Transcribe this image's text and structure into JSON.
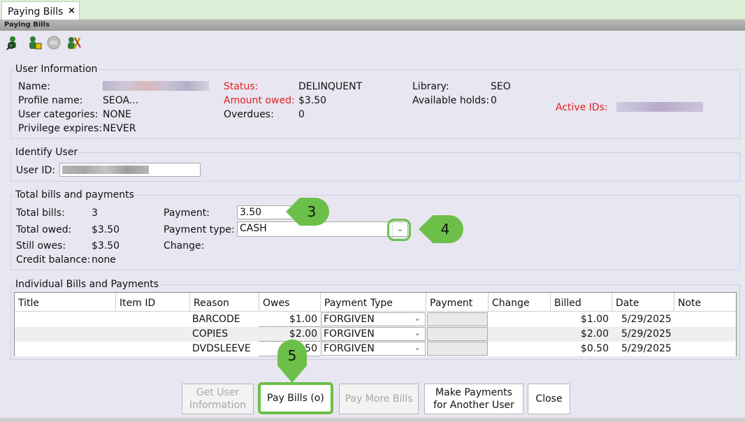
{
  "tab": {
    "label": "Paying Bills",
    "close": "×"
  },
  "window": {
    "title": "Paying Bills"
  },
  "toolbar": {
    "icons": [
      "user-search-icon",
      "user-add-icon",
      "disabled-icon",
      "tools-icon"
    ]
  },
  "user_info": {
    "legend": "User Information",
    "name_label": "Name:",
    "profile_label": "Profile name:",
    "profile_value": "SEOA...",
    "categories_label": "User categories:",
    "categories_value": "NONE",
    "privilege_label": "Privilege expires:",
    "privilege_value": "NEVER",
    "status_label": "Status:",
    "status_value": "DELINQUENT",
    "amount_label": "Amount owed:",
    "amount_value": "$3.50",
    "overdues_label": "Overdues:",
    "overdues_value": "0",
    "library_label": "Library:",
    "library_value": "SEO",
    "holds_label": "Available holds:",
    "holds_value": "0",
    "active_ids_label": "Active IDs:"
  },
  "identify": {
    "legend": "Identify User",
    "user_id_label": "User ID:"
  },
  "totals": {
    "legend": "Total bills and payments",
    "total_bills_label": "Total bills:",
    "total_bills_value": "3",
    "total_owed_label": "Total owed:",
    "total_owed_value": "$3.50",
    "still_owes_label": "Still owes:",
    "still_owes_value": "$3.50",
    "credit_label": "Credit balance:",
    "credit_value": "none",
    "payment_label": "Payment:",
    "payment_value": "3.50",
    "payment_type_label": "Payment type:",
    "payment_type_value": "CASH",
    "change_label": "Change:"
  },
  "bills": {
    "legend": "Individual Bills and Payments",
    "columns": [
      "Title",
      "Item ID",
      "Reason",
      "Owes",
      "Payment Type",
      "Payment",
      "Change",
      "Billed",
      "Date",
      "Note"
    ],
    "rows": [
      {
        "reason": "BARCODE",
        "owes": "$1.00",
        "type": "FORGIVEN",
        "billed": "$1.00",
        "date": "5/29/2025"
      },
      {
        "reason": "COPIES",
        "owes": "$2.00",
        "type": "FORGIVEN",
        "billed": "$2.00",
        "date": "5/29/2025"
      },
      {
        "reason": "DVDSLEEVE",
        "owes": "50",
        "type": "FORGIVEN",
        "billed": "$0.50",
        "date": "5/29/2025"
      }
    ]
  },
  "buttons": {
    "get_user_1": "Get User",
    "get_user_2": "Information",
    "pay_bills": "Pay Bills (o)",
    "pay_more": "Pay More Bills",
    "make_payments_1": "Make Payments",
    "make_payments_2": "for Another User",
    "close": "Close"
  },
  "callouts": {
    "c3": "3",
    "c4": "4",
    "c5": "5"
  },
  "colors": {
    "accent_green": "#6cc04a",
    "status_red": "#e02020",
    "panel_bg": "#e8e6f1"
  }
}
